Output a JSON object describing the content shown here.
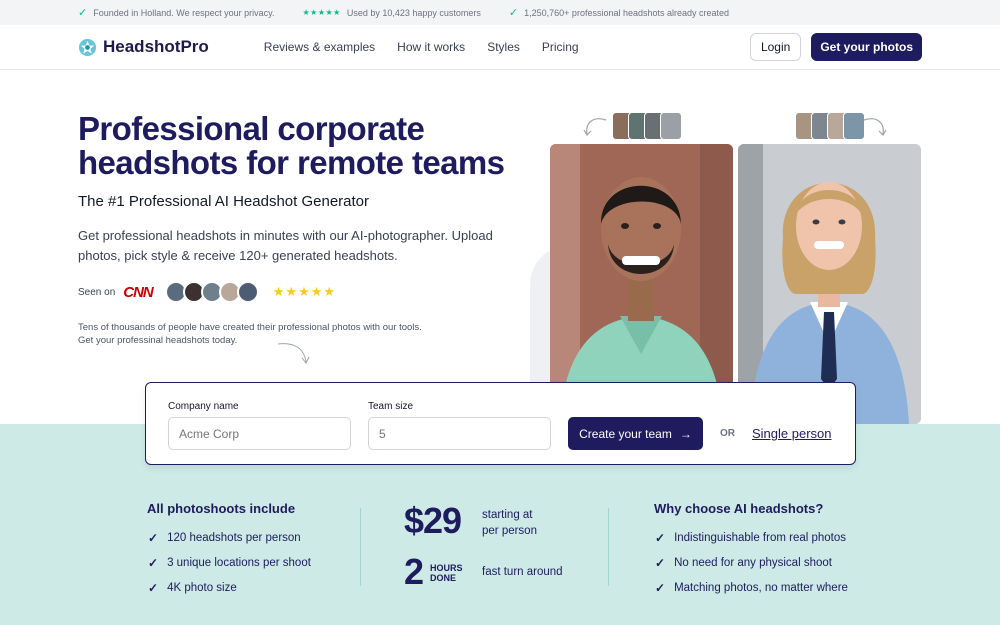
{
  "topbar": {
    "items": [
      {
        "text": "Founded in Holland. We respect your privacy.",
        "icon": "check-icon"
      },
      {
        "text": "Used by 10,423 happy customers",
        "icon": "stars-icon"
      },
      {
        "text": "1,250,760+ professional headshots already created",
        "icon": "check-icon"
      }
    ],
    "stars": "★★★★★"
  },
  "nav": {
    "brand": "HeadshotPro",
    "links": [
      "Reviews & examples",
      "How it works",
      "Styles",
      "Pricing"
    ],
    "login": "Login",
    "cta": "Get your photos"
  },
  "hero": {
    "title": "Professional corporate headshots for remote teams",
    "subtitle": "The #1 Professional AI Headshot Generator",
    "description": "Get professional headshots in minutes with our AI-photographer. Upload photos, pick style & receive 120+ generated headshots.",
    "seen_on": "Seen on",
    "press_logo": "CNN",
    "stars": "★★★★★",
    "tens": "Tens of thousands of people have created their professional photos with our tools. Get your professinal headshots today."
  },
  "form": {
    "company_label": "Company name",
    "company_placeholder": "Acme Corp",
    "team_label": "Team size",
    "team_placeholder": "5",
    "create_button": "Create your team",
    "or": "OR",
    "single_link": "Single person"
  },
  "features": {
    "left_title": "All photoshoots include",
    "left_items": [
      "120 headshots per person",
      "3 unique locations per shoot",
      "4K photo size"
    ],
    "price": "$29",
    "price_note": "starting at per person",
    "hours_num": "2",
    "hours_label": "HOURS DONE",
    "hours_note": "fast turn around",
    "right_title": "Why choose AI headshots?",
    "right_items": [
      "Indistinguishable from real photos",
      "No need for any physical shoot",
      "Matching photos, no matter where"
    ]
  },
  "colors": {
    "brand": "#1e1b5e",
    "teal": "#cdeae6",
    "check": "#10b981",
    "star": "#facc15",
    "cnn": "#cc0000"
  }
}
